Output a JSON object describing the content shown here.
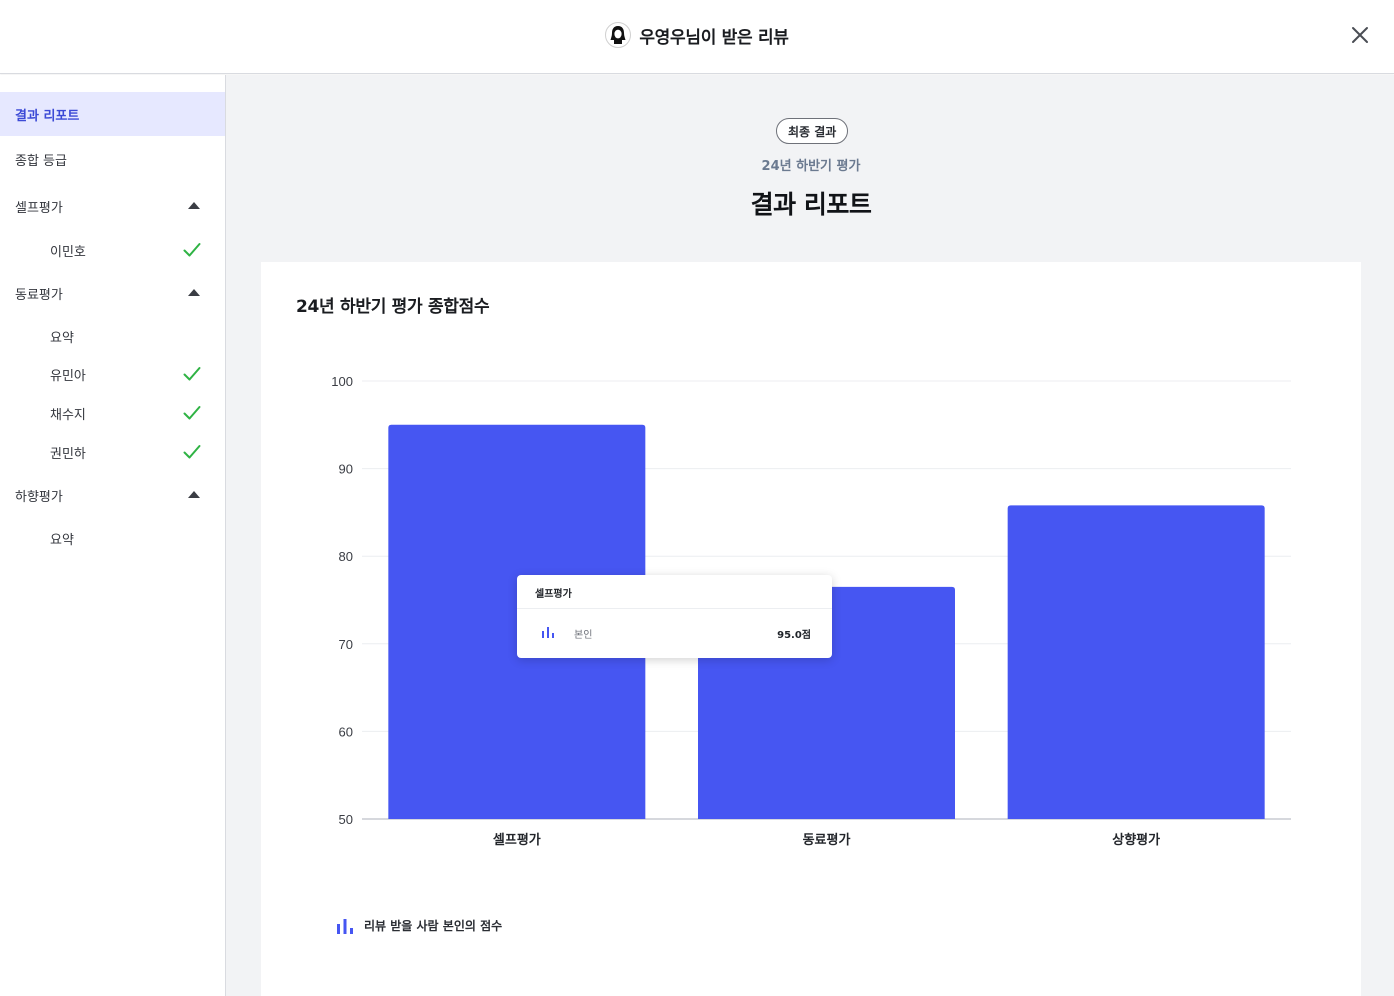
{
  "header": {
    "title": "우영우님이 받은 리뷰",
    "avatar_icon": "user-avatar-icon",
    "close_icon": "close-icon"
  },
  "sidebar": {
    "items": [
      {
        "label": "결과 리포트",
        "active": true
      },
      {
        "label": "종합 등급"
      },
      {
        "label": "셀프평가",
        "expanded": true
      },
      {
        "label": "이민호",
        "checked": true
      },
      {
        "label": "동료평가",
        "expanded": true
      },
      {
        "label": "요약"
      },
      {
        "label": "유민아",
        "checked": true
      },
      {
        "label": "채수지",
        "checked": true
      },
      {
        "label": "권민하",
        "checked": true
      },
      {
        "label": "하향평가",
        "expanded": true
      },
      {
        "label": "요약"
      }
    ]
  },
  "main": {
    "badge": "최종 결과",
    "period": "24년 하반기 평가",
    "title": "결과 리포트",
    "card_title": "24년 하반기 평가 종합점수"
  },
  "tooltip": {
    "title": "셀프평가",
    "label": "본인",
    "value": "95.0점"
  },
  "legend": {
    "label": "리뷰 받을 사람 본인의 점수"
  },
  "colors": {
    "bar": "#4656f2",
    "accent": "#3c4ad6",
    "check": "#2fb344"
  },
  "chart_data": {
    "type": "bar",
    "categories": [
      "셀프평가",
      "동료평가",
      "상향평가"
    ],
    "series": [
      {
        "name": "리뷰 받을 사람 본인의 점수",
        "values": [
          95,
          76.5,
          85.8
        ]
      }
    ],
    "yticks": [
      50,
      60,
      70,
      80,
      90,
      100
    ],
    "ylim": [
      50,
      100
    ],
    "grid": true,
    "legend_position": "bottom-left"
  }
}
